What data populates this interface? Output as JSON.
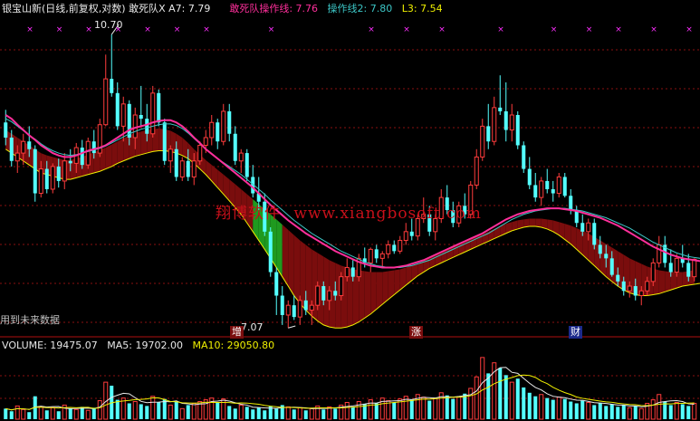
{
  "header": {
    "title_prefix": "银宝山新(日线,前复权,对数)",
    "items": [
      {
        "label": "敢死队X",
        "value": "A7: 7.79",
        "color": "#e8e8e8"
      },
      {
        "label": "敢死队操作线:",
        "value": "7.76",
        "color": "#ff2f9b"
      },
      {
        "label": "操作线2:",
        "value": "7.80",
        "color": "#3cc6c6"
      },
      {
        "label": "L3:",
        "value": "7.54",
        "color": "#f0f000"
      }
    ]
  },
  "annotations": {
    "high_label": "10.70",
    "low_label": "7.07",
    "future_data": "用到未来数据",
    "markers": [
      {
        "text": "增",
        "bg": "#7a0d0d",
        "color": "#ffffff"
      },
      {
        "text": "涨",
        "bg": "#7a0d0d",
        "color": "#ffffff"
      },
      {
        "text": "财",
        "bg": "#1c2a8c",
        "color": "#ffffff"
      }
    ]
  },
  "watermark": {
    "cn": "翔博软件",
    "url": "www.xiangbosoft.com"
  },
  "volume_header": {
    "vol": "VOLUME: 19475.07",
    "ma5": "MA5: 19702.00",
    "ma10": "MA10: 29050.80"
  },
  "colors": {
    "up": "#ff3c3c",
    "down": "#54ffff",
    "band": "#7a0d0d",
    "band_green": "#1f9a1f",
    "ma_pink": "#ff2f9b",
    "ma_cyan": "#3cc6c6",
    "l3": "#f0f000",
    "grid": "#8a0f0f",
    "text_grey": "#c0c0c0",
    "sell_x": "#ff2fff"
  },
  "chart_data": {
    "type": "candlestick",
    "ohlc": [
      [
        9.45,
        9.62,
        9.15,
        9.25
      ],
      [
        9.25,
        9.35,
        8.88,
        8.95
      ],
      [
        8.95,
        9.15,
        8.8,
        9.05
      ],
      [
        9.05,
        9.3,
        8.9,
        9.2
      ],
      [
        9.2,
        9.4,
        9.0,
        9.1
      ],
      [
        9.1,
        9.15,
        8.45,
        8.55
      ],
      [
        8.55,
        8.95,
        8.5,
        8.85
      ],
      [
        8.85,
        8.95,
        8.55,
        8.6
      ],
      [
        8.6,
        8.92,
        8.55,
        8.88
      ],
      [
        8.88,
        8.98,
        8.62,
        8.7
      ],
      [
        8.7,
        9.05,
        8.6,
        8.95
      ],
      [
        8.95,
        9.1,
        8.82,
        8.92
      ],
      [
        8.92,
        9.18,
        8.8,
        9.12
      ],
      [
        9.12,
        9.22,
        8.85,
        8.9
      ],
      [
        8.9,
        9.25,
        8.85,
        9.2
      ],
      [
        9.2,
        9.35,
        8.98,
        9.05
      ],
      [
        9.05,
        9.5,
        9.0,
        9.42
      ],
      [
        9.42,
        10.4,
        9.4,
        10.05
      ],
      [
        10.05,
        10.7,
        9.8,
        9.85
      ],
      [
        9.85,
        10.0,
        9.35,
        9.4
      ],
      [
        9.4,
        9.8,
        9.2,
        9.7
      ],
      [
        9.7,
        9.75,
        9.15,
        9.25
      ],
      [
        9.25,
        9.65,
        9.1,
        9.55
      ],
      [
        9.55,
        9.95,
        9.4,
        9.5
      ],
      [
        9.5,
        9.7,
        9.2,
        9.3
      ],
      [
        9.3,
        9.95,
        9.25,
        9.85
      ],
      [
        9.85,
        9.9,
        9.4,
        9.45
      ],
      [
        9.45,
        9.5,
        8.9,
        8.95
      ],
      [
        8.95,
        9.15,
        8.8,
        9.1
      ],
      [
        9.1,
        9.2,
        8.7,
        8.75
      ],
      [
        8.75,
        9.0,
        8.7,
        8.95
      ],
      [
        8.95,
        9.1,
        8.7,
        8.75
      ],
      [
        8.75,
        9.05,
        8.65,
        8.95
      ],
      [
        8.95,
        9.2,
        8.9,
        9.15
      ],
      [
        9.15,
        9.35,
        9.05,
        9.25
      ],
      [
        9.25,
        9.55,
        9.15,
        9.45
      ],
      [
        9.45,
        9.5,
        9.1,
        9.2
      ],
      [
        9.2,
        9.7,
        9.15,
        9.6
      ],
      [
        9.6,
        9.7,
        9.2,
        9.3
      ],
      [
        9.3,
        9.4,
        8.9,
        8.95
      ],
      [
        8.95,
        9.1,
        8.8,
        9.05
      ],
      [
        9.05,
        9.1,
        8.7,
        8.75
      ],
      [
        8.75,
        8.9,
        8.5,
        8.55
      ],
      [
        8.55,
        8.75,
        8.35,
        8.45
      ],
      [
        8.45,
        8.55,
        8.05,
        8.1
      ],
      [
        8.1,
        8.15,
        7.6,
        7.65
      ],
      [
        7.65,
        7.7,
        7.2,
        7.4
      ],
      [
        7.4,
        7.5,
        7.1,
        7.2
      ],
      [
        7.2,
        7.35,
        7.07,
        7.3
      ],
      [
        7.3,
        7.4,
        7.15,
        7.18
      ],
      [
        7.18,
        7.4,
        7.1,
        7.35
      ],
      [
        7.35,
        7.45,
        7.2,
        7.25
      ],
      [
        7.25,
        7.35,
        7.1,
        7.3
      ],
      [
        7.3,
        7.55,
        7.25,
        7.5
      ],
      [
        7.5,
        7.55,
        7.3,
        7.35
      ],
      [
        7.35,
        7.5,
        7.25,
        7.45
      ],
      [
        7.45,
        7.55,
        7.35,
        7.4
      ],
      [
        7.4,
        7.65,
        7.35,
        7.6
      ],
      [
        7.6,
        7.8,
        7.55,
        7.7
      ],
      [
        7.7,
        7.78,
        7.55,
        7.6
      ],
      [
        7.6,
        7.85,
        7.55,
        7.8
      ],
      [
        7.8,
        7.92,
        7.7,
        7.75
      ],
      [
        7.75,
        7.92,
        7.65,
        7.9
      ],
      [
        7.9,
        7.95,
        7.75,
        7.8
      ],
      [
        7.8,
        7.88,
        7.7,
        7.85
      ],
      [
        7.85,
        8.0,
        7.8,
        7.95
      ],
      [
        7.95,
        8.0,
        7.85,
        7.88
      ],
      [
        7.88,
        8.05,
        7.85,
        8.0
      ],
      [
        8.0,
        8.2,
        7.95,
        8.1
      ],
      [
        8.1,
        8.25,
        8.0,
        8.05
      ],
      [
        8.05,
        8.3,
        8.0,
        8.25
      ],
      [
        8.25,
        8.5,
        8.2,
        8.3
      ],
      [
        8.3,
        8.4,
        8.05,
        8.1
      ],
      [
        8.1,
        8.3,
        8.0,
        8.25
      ],
      [
        8.25,
        8.6,
        8.2,
        8.5
      ],
      [
        8.5,
        8.65,
        8.3,
        8.35
      ],
      [
        8.35,
        8.45,
        8.15,
        8.2
      ],
      [
        8.2,
        8.45,
        8.15,
        8.4
      ],
      [
        8.4,
        8.55,
        8.25,
        8.3
      ],
      [
        8.3,
        8.7,
        8.25,
        8.65
      ],
      [
        8.65,
        9.1,
        8.6,
        9.0
      ],
      [
        9.0,
        9.5,
        8.95,
        9.4
      ],
      [
        9.4,
        9.7,
        9.1,
        9.2
      ],
      [
        9.2,
        9.8,
        9.15,
        9.65
      ],
      [
        9.65,
        10.1,
        9.55,
        9.6
      ],
      [
        9.6,
        10.0,
        9.2,
        9.35
      ],
      [
        9.35,
        9.7,
        9.2,
        9.55
      ],
      [
        9.55,
        9.6,
        9.1,
        9.15
      ],
      [
        9.15,
        9.2,
        8.8,
        8.85
      ],
      [
        8.85,
        9.0,
        8.6,
        8.65
      ],
      [
        8.65,
        8.8,
        8.45,
        8.5
      ],
      [
        8.5,
        8.75,
        8.4,
        8.7
      ],
      [
        8.7,
        8.85,
        8.55,
        8.6
      ],
      [
        8.6,
        8.7,
        8.45,
        8.55
      ],
      [
        8.55,
        8.8,
        8.5,
        8.75
      ],
      [
        8.75,
        8.8,
        8.5,
        8.52
      ],
      [
        8.52,
        8.6,
        8.3,
        8.35
      ],
      [
        8.35,
        8.4,
        8.15,
        8.2
      ],
      [
        8.2,
        8.3,
        8.05,
        8.1
      ],
      [
        8.1,
        8.25,
        8.0,
        8.2
      ],
      [
        8.2,
        8.25,
        7.9,
        7.95
      ],
      [
        7.95,
        8.05,
        7.8,
        7.85
      ],
      [
        7.85,
        7.95,
        7.7,
        7.8
      ],
      [
        7.8,
        7.88,
        7.6,
        7.62
      ],
      [
        7.62,
        7.7,
        7.5,
        7.55
      ],
      [
        7.55,
        7.6,
        7.4,
        7.45
      ],
      [
        7.45,
        7.55,
        7.38,
        7.5
      ],
      [
        7.5,
        7.58,
        7.35,
        7.4
      ],
      [
        7.4,
        7.5,
        7.3,
        7.45
      ],
      [
        7.45,
        7.6,
        7.4,
        7.55
      ],
      [
        7.55,
        7.8,
        7.5,
        7.75
      ],
      [
        7.75,
        8.05,
        7.7,
        7.95
      ],
      [
        7.95,
        8.05,
        7.7,
        7.75
      ],
      [
        7.75,
        7.9,
        7.6,
        7.65
      ],
      [
        7.65,
        7.85,
        7.6,
        7.8
      ],
      [
        7.8,
        7.95,
        7.7,
        7.75
      ],
      [
        7.75,
        7.85,
        7.55,
        7.6
      ],
      [
        7.6,
        7.8,
        7.55,
        7.79
      ]
    ],
    "ma_pink": [
      9.55,
      9.5,
      9.42,
      9.35,
      9.28,
      9.22,
      9.15,
      9.1,
      9.05,
      9.02,
      9.0,
      9.0,
      9.02,
      9.05,
      9.08,
      9.1,
      9.12,
      9.15,
      9.2,
      9.25,
      9.3,
      9.35,
      9.38,
      9.4,
      9.42,
      9.45,
      9.47,
      9.48,
      9.48,
      9.45,
      9.4,
      9.33,
      9.25,
      9.18,
      9.1,
      9.04,
      8.98,
      8.92,
      8.86,
      8.8,
      8.74,
      8.68,
      8.62,
      8.55,
      8.48,
      8.41,
      8.35,
      8.29,
      8.23,
      8.18,
      8.13,
      8.08,
      8.04,
      8.0,
      7.96,
      7.92,
      7.88,
      7.85,
      7.82,
      7.79,
      7.76,
      7.74,
      7.72,
      7.71,
      7.7,
      7.7,
      7.7,
      7.71,
      7.72,
      7.74,
      7.76,
      7.78,
      7.81,
      7.84,
      7.87,
      7.9,
      7.93,
      7.96,
      7.99,
      8.02,
      8.05,
      8.08,
      8.12,
      8.16,
      8.2,
      8.24,
      8.27,
      8.3,
      8.32,
      8.34,
      8.35,
      8.36,
      8.37,
      8.37,
      8.37,
      8.36,
      8.35,
      8.34,
      8.32,
      8.3,
      8.28,
      8.26,
      8.23,
      8.2,
      8.17,
      8.13,
      8.09,
      8.05,
      8.01,
      7.97,
      7.93,
      7.9,
      7.87,
      7.84,
      7.82,
      7.8,
      7.79,
      7.78,
      7.77,
      7.76
    ],
    "ma_cyan": [
      9.5,
      9.46,
      9.4,
      9.34,
      9.28,
      9.23,
      9.17,
      9.12,
      9.08,
      9.05,
      9.03,
      9.02,
      9.03,
      9.05,
      9.07,
      9.09,
      9.11,
      9.14,
      9.18,
      9.22,
      9.26,
      9.3,
      9.33,
      9.36,
      9.38,
      9.4,
      9.42,
      9.43,
      9.43,
      9.41,
      9.37,
      9.31,
      9.24,
      9.17,
      9.1,
      9.04,
      8.98,
      8.93,
      8.88,
      8.83,
      8.78,
      8.72,
      8.66,
      8.6,
      8.54,
      8.47,
      8.41,
      8.35,
      8.29,
      8.23,
      8.18,
      8.13,
      8.08,
      8.04,
      8.0,
      7.96,
      7.92,
      7.88,
      7.85,
      7.82,
      7.79,
      7.76,
      7.74,
      7.72,
      7.71,
      7.7,
      7.7,
      7.7,
      7.71,
      7.72,
      7.74,
      7.76,
      7.78,
      7.81,
      7.84,
      7.87,
      7.9,
      7.93,
      7.96,
      7.99,
      8.02,
      8.05,
      8.08,
      8.12,
      8.16,
      8.2,
      8.24,
      8.27,
      8.3,
      8.32,
      8.34,
      8.35,
      8.36,
      8.37,
      8.37,
      8.37,
      8.36,
      8.35,
      8.34,
      8.32,
      8.3,
      8.28,
      8.26,
      8.23,
      8.2,
      8.17,
      8.14,
      8.1,
      8.06,
      8.02,
      7.98,
      7.95,
      7.92,
      7.89,
      7.86,
      7.84,
      7.82,
      7.81,
      7.8,
      7.8
    ],
    "band_upper": [
      9.35,
      9.3,
      9.25,
      9.2,
      9.15,
      9.1,
      9.05,
      9.02,
      9.0,
      8.98,
      8.96,
      8.96,
      8.98,
      9.0,
      9.03,
      9.06,
      9.09,
      9.12,
      9.16,
      9.2,
      9.24,
      9.28,
      9.31,
      9.33,
      9.35,
      9.36,
      9.37,
      9.36,
      9.34,
      9.3,
      9.25,
      9.18,
      9.1,
      9.03,
      8.96,
      8.9,
      8.84,
      8.78,
      8.72,
      8.66,
      8.6,
      8.54,
      8.48,
      8.42,
      8.36,
      8.3,
      8.24,
      8.18,
      8.12,
      8.06,
      8.0,
      7.95,
      7.9,
      7.86,
      7.82,
      7.78,
      7.75,
      7.72,
      7.7,
      7.68,
      7.67,
      7.66,
      7.65,
      7.65,
      7.65,
      7.66,
      7.67,
      7.68,
      7.7,
      7.72,
      7.74,
      7.77,
      7.8,
      7.83,
      7.86,
      7.89,
      7.92,
      7.95,
      7.98,
      8.01,
      8.04,
      8.07,
      8.1,
      8.13,
      8.16,
      8.19,
      8.21,
      8.23,
      8.24,
      8.25,
      8.25,
      8.25,
      8.24,
      8.23,
      8.21,
      8.19,
      8.17,
      8.14,
      8.11,
      8.08,
      8.04,
      8.0,
      7.96,
      7.92,
      7.88,
      7.84,
      7.8,
      7.77,
      7.74,
      7.71,
      7.69,
      7.67,
      7.66,
      7.65,
      7.65,
      7.65,
      7.66,
      7.67,
      7.68,
      7.7
    ],
    "l3": [
      9.1,
      9.05,
      9.0,
      8.95,
      8.9,
      8.85,
      8.8,
      8.78,
      8.76,
      8.74,
      8.72,
      8.72,
      8.74,
      8.76,
      8.78,
      8.8,
      8.82,
      8.85,
      8.88,
      8.92,
      8.95,
      8.98,
      9.01,
      9.03,
      9.05,
      9.07,
      9.08,
      9.08,
      9.07,
      9.05,
      9.02,
      8.98,
      8.92,
      8.85,
      8.78,
      8.7,
      8.62,
      8.54,
      8.46,
      8.38,
      8.3,
      8.2,
      8.1,
      8.0,
      7.9,
      7.8,
      7.7,
      7.6,
      7.5,
      7.4,
      7.32,
      7.25,
      7.19,
      7.14,
      7.1,
      7.08,
      7.07,
      7.07,
      7.08,
      7.1,
      7.13,
      7.17,
      7.21,
      7.26,
      7.31,
      7.36,
      7.41,
      7.46,
      7.51,
      7.56,
      7.61,
      7.65,
      7.69,
      7.72,
      7.75,
      7.78,
      7.81,
      7.84,
      7.87,
      7.9,
      7.93,
      7.96,
      7.99,
      8.02,
      8.05,
      8.08,
      8.11,
      8.13,
      8.15,
      8.16,
      8.16,
      8.15,
      8.13,
      8.1,
      8.06,
      8.01,
      7.96,
      7.9,
      7.84,
      7.78,
      7.72,
      7.66,
      7.6,
      7.55,
      7.5,
      7.46,
      7.43,
      7.41,
      7.4,
      7.4,
      7.41,
      7.42,
      7.44,
      7.46,
      7.48,
      7.5,
      7.51,
      7.52,
      7.53,
      7.54
    ],
    "volume": [
      12000,
      9000,
      15000,
      11000,
      8000,
      26000,
      14000,
      10000,
      13000,
      9000,
      16000,
      12000,
      11000,
      14000,
      10000,
      13000,
      21000,
      42000,
      38000,
      22000,
      24000,
      18000,
      20000,
      17000,
      15000,
      26000,
      19000,
      23000,
      16000,
      20000,
      12000,
      16000,
      18000,
      20000,
      22000,
      24000,
      19000,
      23000,
      15000,
      12000,
      16000,
      14000,
      11000,
      13000,
      10000,
      15000,
      12000,
      16000,
      14000,
      11000,
      13000,
      10000,
      12000,
      15000,
      11000,
      14000,
      12000,
      16000,
      19000,
      14000,
      20000,
      17000,
      22000,
      18000,
      24000,
      21000,
      19000,
      23000,
      26000,
      22000,
      28000,
      25000,
      21000,
      24000,
      30000,
      27000,
      23000,
      25000,
      29000,
      35000,
      48000,
      70000,
      52000,
      64000,
      58000,
      50000,
      42000,
      46000,
      36000,
      30000,
      26000,
      28000,
      24000,
      22000,
      25000,
      23000,
      20000,
      18000,
      21000,
      19000,
      16000,
      18000,
      15000,
      17000,
      14000,
      16000,
      13000,
      15000,
      12000,
      18000,
      22000,
      28000,
      20000,
      16000,
      19000,
      17000,
      15000,
      18000
    ],
    "price_range": [
      7.0,
      10.95
    ],
    "volume_range": [
      0,
      75000
    ]
  }
}
